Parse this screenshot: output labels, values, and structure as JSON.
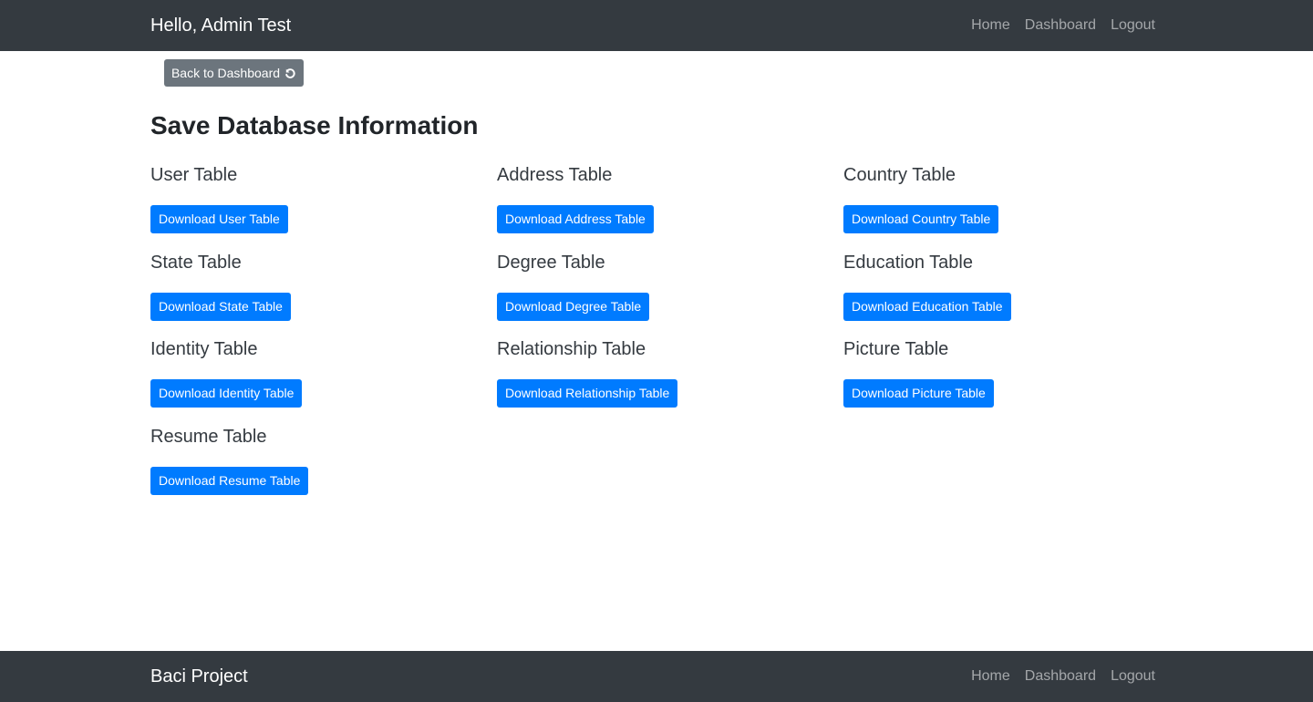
{
  "header": {
    "brand": "Hello, Admin Test",
    "nav": [
      "Home",
      "Dashboard",
      "Logout"
    ]
  },
  "back_button": {
    "label": "Back to Dashboard",
    "icon": "undo-icon"
  },
  "page_title": "Save Database Information",
  "tables": [
    {
      "label": "User Table",
      "button": "Download User Table"
    },
    {
      "label": "Address Table",
      "button": "Download Address Table"
    },
    {
      "label": "Country Table",
      "button": "Download Country Table"
    },
    {
      "label": "State Table",
      "button": "Download State Table"
    },
    {
      "label": "Degree Table",
      "button": "Download Degree Table"
    },
    {
      "label": "Education Table",
      "button": "Download Education Table"
    },
    {
      "label": "Identity Table",
      "button": "Download Identity Table"
    },
    {
      "label": "Relationship Table",
      "button": "Download Relationship Table"
    },
    {
      "label": "Picture Table",
      "button": "Download Picture Table"
    },
    {
      "label": "Resume Table",
      "button": "Download Resume Table"
    }
  ],
  "footer": {
    "brand": "Baci Project",
    "nav": [
      "Home",
      "Dashboard",
      "Logout"
    ]
  },
  "colors": {
    "navbar": "#343a40",
    "primary": "#007bff",
    "secondary": "#6c757d"
  }
}
